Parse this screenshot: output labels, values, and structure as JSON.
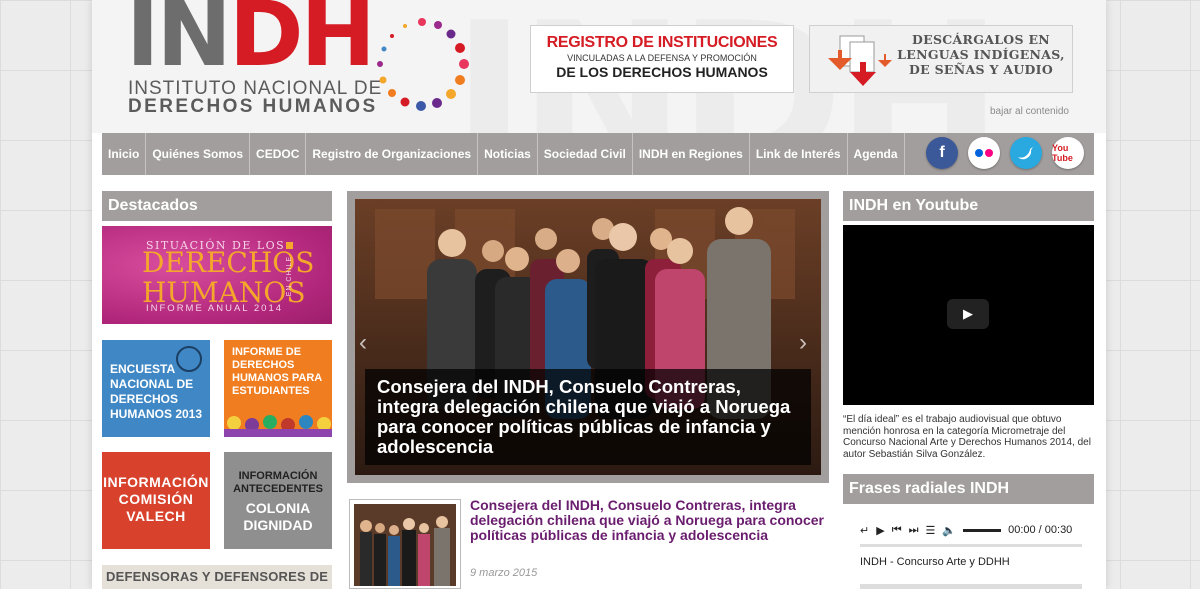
{
  "header": {
    "logo_letters_grey": "IN",
    "logo_letters_red": "DH",
    "logo_line1": "INSTITUTO NACIONAL DE",
    "logo_line2": "DERECHOS HUMANOS",
    "registro_line1": "REGISTRO DE INSTITUCIONES",
    "registro_line2": "VINCULADAS A LA DEFENSA Y PROMOCIÓN",
    "registro_line3": "DE LOS DERECHOS HUMANOS",
    "descarga_text": "Descárgalos en lenguas indígenas, de señas y audio",
    "skip_link": "bajar al contenido",
    "watermark": "INDH"
  },
  "nav": {
    "items": [
      "Inicio",
      "Quiénes Somos",
      "CEDOC",
      "Registro de Organizaciones",
      "Noticias",
      "Sociedad Civil",
      "INDH en Regiones",
      "Link de Interés",
      "Agenda"
    ],
    "social": {
      "facebook": "f",
      "youtube": "You Tube"
    }
  },
  "left": {
    "heading": "Destacados",
    "informe": {
      "line1": "SITUACIÓN DE LOS",
      "line2": "DERECHOS",
      "line3": "HUMANOS",
      "line4": "INFORME ANUAL 2014",
      "side": "EN CHILE"
    },
    "encuesta": "ENCUESTA NACIONAL DE DERECHOS HUMANOS 2013",
    "estudiantes": "INFORME DE DERECHOS HUMANOS PARA ESTUDIANTES",
    "valech": "INFORMACIÓN COMISIÓN VALECH",
    "colonia_line1": "INFORMACIÓN ANTECEDENTES",
    "colonia_line2": "COLONIA DIGNIDAD",
    "defensoras": "DEFENSORAS Y DEFENSORES DE"
  },
  "center": {
    "slide_caption": "Consejera del INDH, Consuelo Contreras, integra delegación chilena que viajó a Noruega para conocer políticas públicas de infancia y adolescencia",
    "news_title": "Consejera del INDH, Consuelo Contreras, integra delegación chilena que viajó a Noruega para conocer políticas públicas de infancia y adolescencia",
    "news_date": "9 marzo 2015"
  },
  "right": {
    "youtube_heading": "INDH en Youtube",
    "video_desc": "“El día ideal” es el trabajo audiovisual que obtuvo mención honrosa en la categoría Micrometraje del Concurso Nacional Arte y Derechos Humanos 2014, del autor Sebastián Silva González.",
    "radio_heading": "Frases radiales INDH",
    "player_time": "00:00 / 00:30",
    "track_name": "INDH - Concurso Arte y DDHH"
  },
  "colors": {
    "brand_red": "#d51c24",
    "nav_grey": "#a39e9e",
    "news_purple": "#6a1d6e",
    "informe_magenta": "#b0267a",
    "encuesta_blue": "#3f88c5",
    "estudiantes_orange": "#f07d1f",
    "valech_red": "#d8412c",
    "colonia_grey": "#8f8f8f"
  }
}
